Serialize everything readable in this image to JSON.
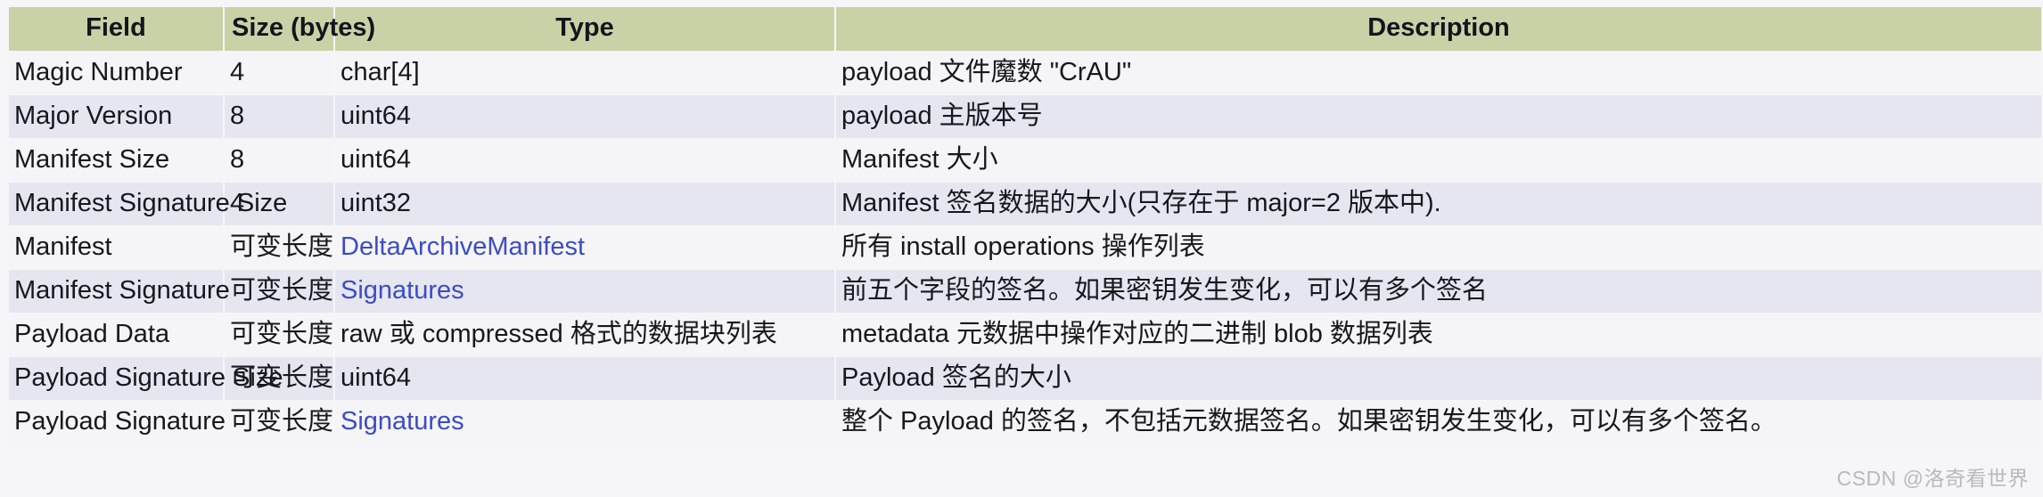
{
  "table": {
    "headers": [
      {
        "label": "Field",
        "key": "field"
      },
      {
        "label": "Size (bytes)",
        "key": "size"
      },
      {
        "label": "Type",
        "key": "type"
      },
      {
        "label": "Description",
        "key": "description"
      }
    ],
    "header_bg": "#c9d2a7",
    "row_bg_odd": "#f5f5f7",
    "row_bg_even": "#e5e6ef",
    "link_color": "#3c4cc4",
    "rows": [
      {
        "field": "Magic Number",
        "size": "4",
        "type": "char[4]",
        "type_is_link": false,
        "description": "payload 文件魔数 \"CrAU\""
      },
      {
        "field": "Major Version",
        "size": "8",
        "type": "uint64",
        "type_is_link": false,
        "description": "payload 主版本号"
      },
      {
        "field": "Manifest Size",
        "size": "8",
        "type": "uint64",
        "type_is_link": false,
        "description": "Manifest 大小"
      },
      {
        "field": "Manifest Signature Size",
        "size": "4",
        "type": "uint32",
        "type_is_link": false,
        "description": "Manifest 签名数据的大小(只存在于 major=2 版本中)."
      },
      {
        "field": "Manifest",
        "size": "可变长度",
        "type": "DeltaArchiveManifest",
        "type_is_link": true,
        "description": "所有 install operations 操作列表"
      },
      {
        "field": "Manifest Signature",
        "size": "可变长度",
        "type": "Signatures",
        "type_is_link": true,
        "description": "前五个字段的签名。如果密钥发生变化，可以有多个签名"
      },
      {
        "field": "Payload Data",
        "size": "可变长度",
        "type": "raw 或 compressed 格式的数据块列表",
        "type_is_link": false,
        "description": "metadata 元数据中操作对应的二进制 blob 数据列表"
      },
      {
        "field": "Payload Signature Size",
        "size": "可变长度",
        "type": "uint64",
        "type_is_link": false,
        "description": "Payload 签名的大小"
      },
      {
        "field": "Payload Signature",
        "size": "可变长度",
        "type": "Signatures",
        "type_is_link": true,
        "description": "整个 Payload 的签名，不包括元数据签名。如果密钥发生变化，可以有多个签名。"
      }
    ]
  },
  "watermark": {
    "text": "CSDN @洛奇看世界"
  }
}
